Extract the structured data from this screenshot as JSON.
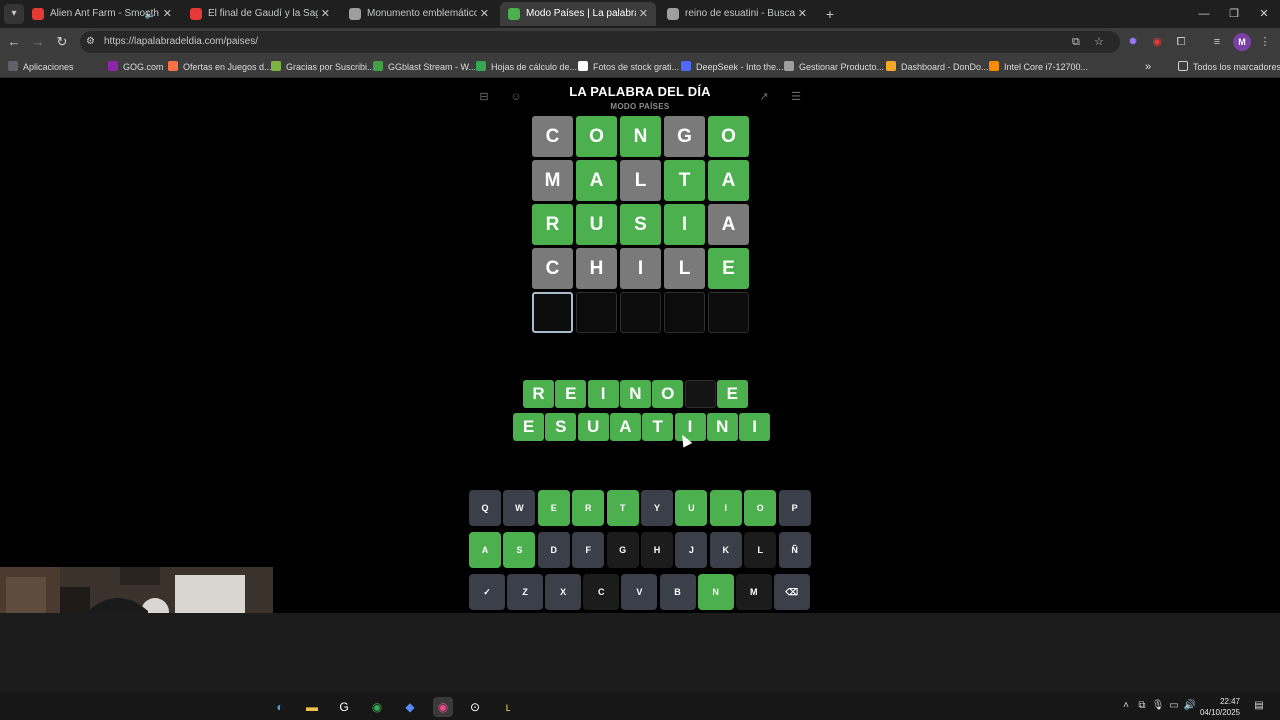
{
  "browser": {
    "tabs": [
      {
        "title": "Alien Ant Farm - Smooth C",
        "has_audio": true,
        "favicon_color": "#e53935",
        "active": false
      },
      {
        "title": "El final de Gaudí y la Sagrada F",
        "has_audio": false,
        "favicon_color": "#e53935",
        "active": false
      },
      {
        "title": "Monumento emblemático de E",
        "has_audio": false,
        "favicon_color": "#9e9e9e",
        "active": false
      },
      {
        "title": "Modo Países | La palabra del dí",
        "has_audio": false,
        "favicon_color": "#4cb04f",
        "active": true
      },
      {
        "title": "reino de esuatini - Buscar con G",
        "has_audio": false,
        "favicon_color": "#9e9e9e",
        "active": false
      }
    ],
    "url": "https://lapalabradeldia.com/paises/",
    "bookmarks": [
      {
        "label": "Aplicaciones",
        "icon_color": "#5f6368"
      },
      {
        "label": "GOG.com",
        "icon_color": "#8e24aa"
      },
      {
        "label": "Ofertas en Juegos d...",
        "icon_color": "#ff7043"
      },
      {
        "label": "Gracias por Suscribi...",
        "icon_color": "#7cb342"
      },
      {
        "label": "GGblast Stream - W...",
        "icon_color": "#43a047"
      },
      {
        "label": "Hojas de cálculo de...",
        "icon_color": "#34a853"
      },
      {
        "label": "Fotos de stock grati...",
        "icon_color": "#ffffff"
      },
      {
        "label": "DeepSeek - Into the...",
        "icon_color": "#4d6bfe"
      },
      {
        "label": "Gestionar Producto...",
        "icon_color": "#9e9e9e"
      },
      {
        "label": "Dashboard - DonDo...",
        "icon_color": "#f9a825"
      },
      {
        "label": "Intel Core i7-12700...",
        "icon_color": "#fb8c00"
      }
    ],
    "all_bookmarks_label": "Todos los marcadores",
    "profile_initial": "M"
  },
  "game": {
    "title": "LA PALABRA DEL DÍA",
    "mode": "MODO PAÍSES",
    "colors": {
      "correct": "#4cb04f",
      "absent": "#7a7a7a",
      "key_unused": "#3a3f4a",
      "key_absent": "#1c1c1c"
    },
    "grid": [
      [
        {
          "l": "C",
          "s": "absent"
        },
        {
          "l": "O",
          "s": "correct"
        },
        {
          "l": "N",
          "s": "correct"
        },
        {
          "l": "G",
          "s": "absent"
        },
        {
          "l": "O",
          "s": "correct"
        }
      ],
      [
        {
          "l": "M",
          "s": "absent"
        },
        {
          "l": "A",
          "s": "correct"
        },
        {
          "l": "L",
          "s": "absent"
        },
        {
          "l": "T",
          "s": "correct"
        },
        {
          "l": "A",
          "s": "correct"
        }
      ],
      [
        {
          "l": "R",
          "s": "correct"
        },
        {
          "l": "U",
          "s": "correct"
        },
        {
          "l": "S",
          "s": "correct"
        },
        {
          "l": "I",
          "s": "correct"
        },
        {
          "l": "A",
          "s": "absent"
        }
      ],
      [
        {
          "l": "C",
          "s": "absent"
        },
        {
          "l": "H",
          "s": "absent"
        },
        {
          "l": "I",
          "s": "absent"
        },
        {
          "l": "L",
          "s": "absent"
        },
        {
          "l": "E",
          "s": "correct"
        }
      ],
      [
        {
          "l": "",
          "s": "focus"
        },
        {
          "l": "",
          "s": "empty"
        },
        {
          "l": "",
          "s": "empty"
        },
        {
          "l": "",
          "s": "empty"
        },
        {
          "l": "",
          "s": "empty"
        }
      ]
    ],
    "solution_lines": [
      [
        "R",
        "E",
        "I",
        "N",
        "O",
        " ",
        "E"
      ],
      [
        "E",
        "S",
        "U",
        "A",
        "T",
        "I",
        "N",
        "I"
      ]
    ],
    "keyboard": [
      [
        {
          "k": "Q",
          "s": "unused"
        },
        {
          "k": "W",
          "s": "unused"
        },
        {
          "k": "E",
          "s": "correct"
        },
        {
          "k": "R",
          "s": "correct"
        },
        {
          "k": "T",
          "s": "correct"
        },
        {
          "k": "Y",
          "s": "unused"
        },
        {
          "k": "U",
          "s": "correct"
        },
        {
          "k": "I",
          "s": "correct"
        },
        {
          "k": "O",
          "s": "correct"
        },
        {
          "k": "P",
          "s": "unused"
        }
      ],
      [
        {
          "k": "A",
          "s": "correct"
        },
        {
          "k": "S",
          "s": "correct"
        },
        {
          "k": "D",
          "s": "unused"
        },
        {
          "k": "F",
          "s": "unused"
        },
        {
          "k": "G",
          "s": "absent"
        },
        {
          "k": "H",
          "s": "absent"
        },
        {
          "k": "J",
          "s": "unused"
        },
        {
          "k": "K",
          "s": "unused"
        },
        {
          "k": "L",
          "s": "absent"
        },
        {
          "k": "Ñ",
          "s": "unused"
        }
      ],
      [
        {
          "k": "✓",
          "s": "unused"
        },
        {
          "k": "Z",
          "s": "unused"
        },
        {
          "k": "X",
          "s": "unused"
        },
        {
          "k": "C",
          "s": "absent"
        },
        {
          "k": "V",
          "s": "unused"
        },
        {
          "k": "B",
          "s": "unused"
        },
        {
          "k": "N",
          "s": "correct"
        },
        {
          "k": "M",
          "s": "absent"
        },
        {
          "k": "⌫",
          "s": "unused"
        }
      ]
    ]
  },
  "taskbar": {
    "time": "22:47",
    "date": "04/10/2025"
  }
}
